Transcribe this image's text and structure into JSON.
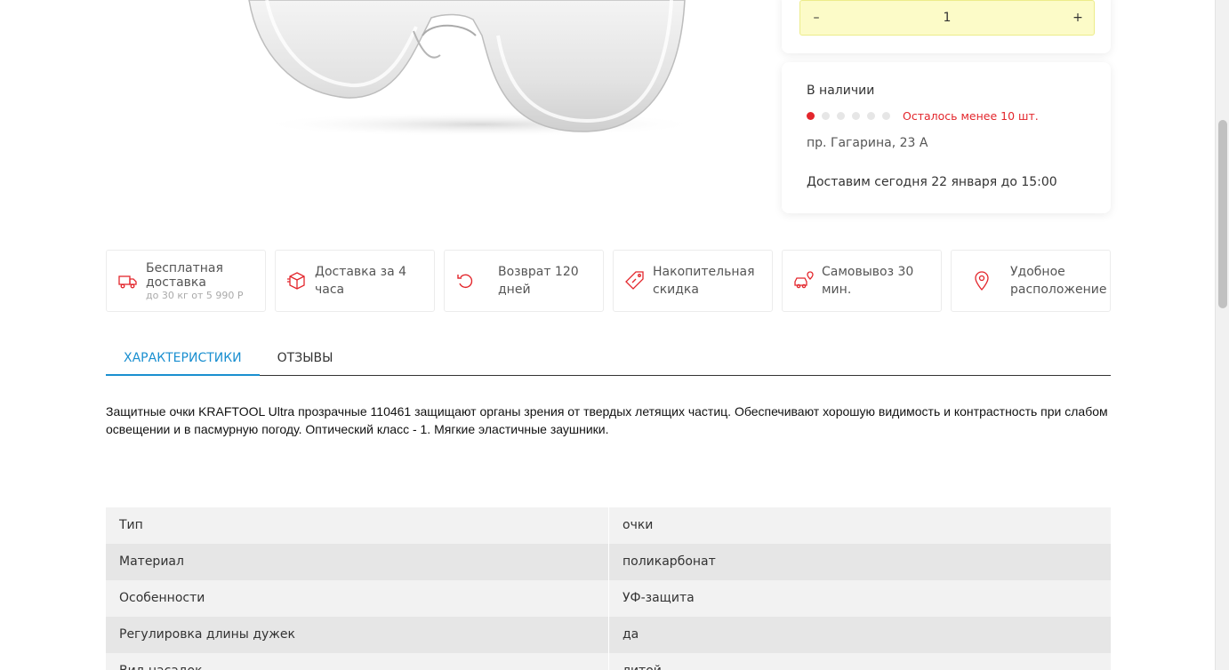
{
  "quantity": {
    "minus": "–",
    "value": "1",
    "plus": "+"
  },
  "stock": {
    "title": "В наличии",
    "level_filled": 1,
    "level_total": 6,
    "left_text": "Осталось менее 10 шт.",
    "address": "пр. Гагарина, 23 А",
    "delivery": "Доставим сегодня 22 января до 15:00",
    "accent_color": "#e3262c"
  },
  "features": [
    {
      "icon": "truck-icon",
      "title": "Бесплатная доставка",
      "sub": "до 30 кг от 5 990 Р"
    },
    {
      "icon": "box-icon",
      "title": "Доставка за 4 часа"
    },
    {
      "icon": "return-icon",
      "title": "Возврат 120 дней"
    },
    {
      "icon": "discount-tag-icon",
      "title": "Накопительная скидка"
    },
    {
      "icon": "car-pickup-icon",
      "title": "Самовывоз 30 мин."
    },
    {
      "icon": "location-pin-icon",
      "title": "Удобное расположение"
    }
  ],
  "tabs": [
    {
      "label": "ХАРАКТЕРИСТИКИ",
      "active": true
    },
    {
      "label": "ОТЗЫВЫ",
      "active": false
    }
  ],
  "tab_active_color": "#1a8fd0",
  "description": "Защитные очки KRAFTOOL Ultra прозрачные 110461 защищают органы зрения от твердых летящих частиц. Обеспечивают хорошую видимость и контрастность при слабом освещении и в пасмурную погоду. Оптический класс - 1. Мягкие эластичные заушники.",
  "specs": [
    {
      "name": "Тип",
      "value": "очки"
    },
    {
      "name": "Материал",
      "value": "поликарбонат"
    },
    {
      "name": "Особенности",
      "value": "УФ-защита"
    },
    {
      "name": "Регулировка длины дужек",
      "value": "да"
    },
    {
      "name": "Вид насадок",
      "value": "литой"
    }
  ]
}
